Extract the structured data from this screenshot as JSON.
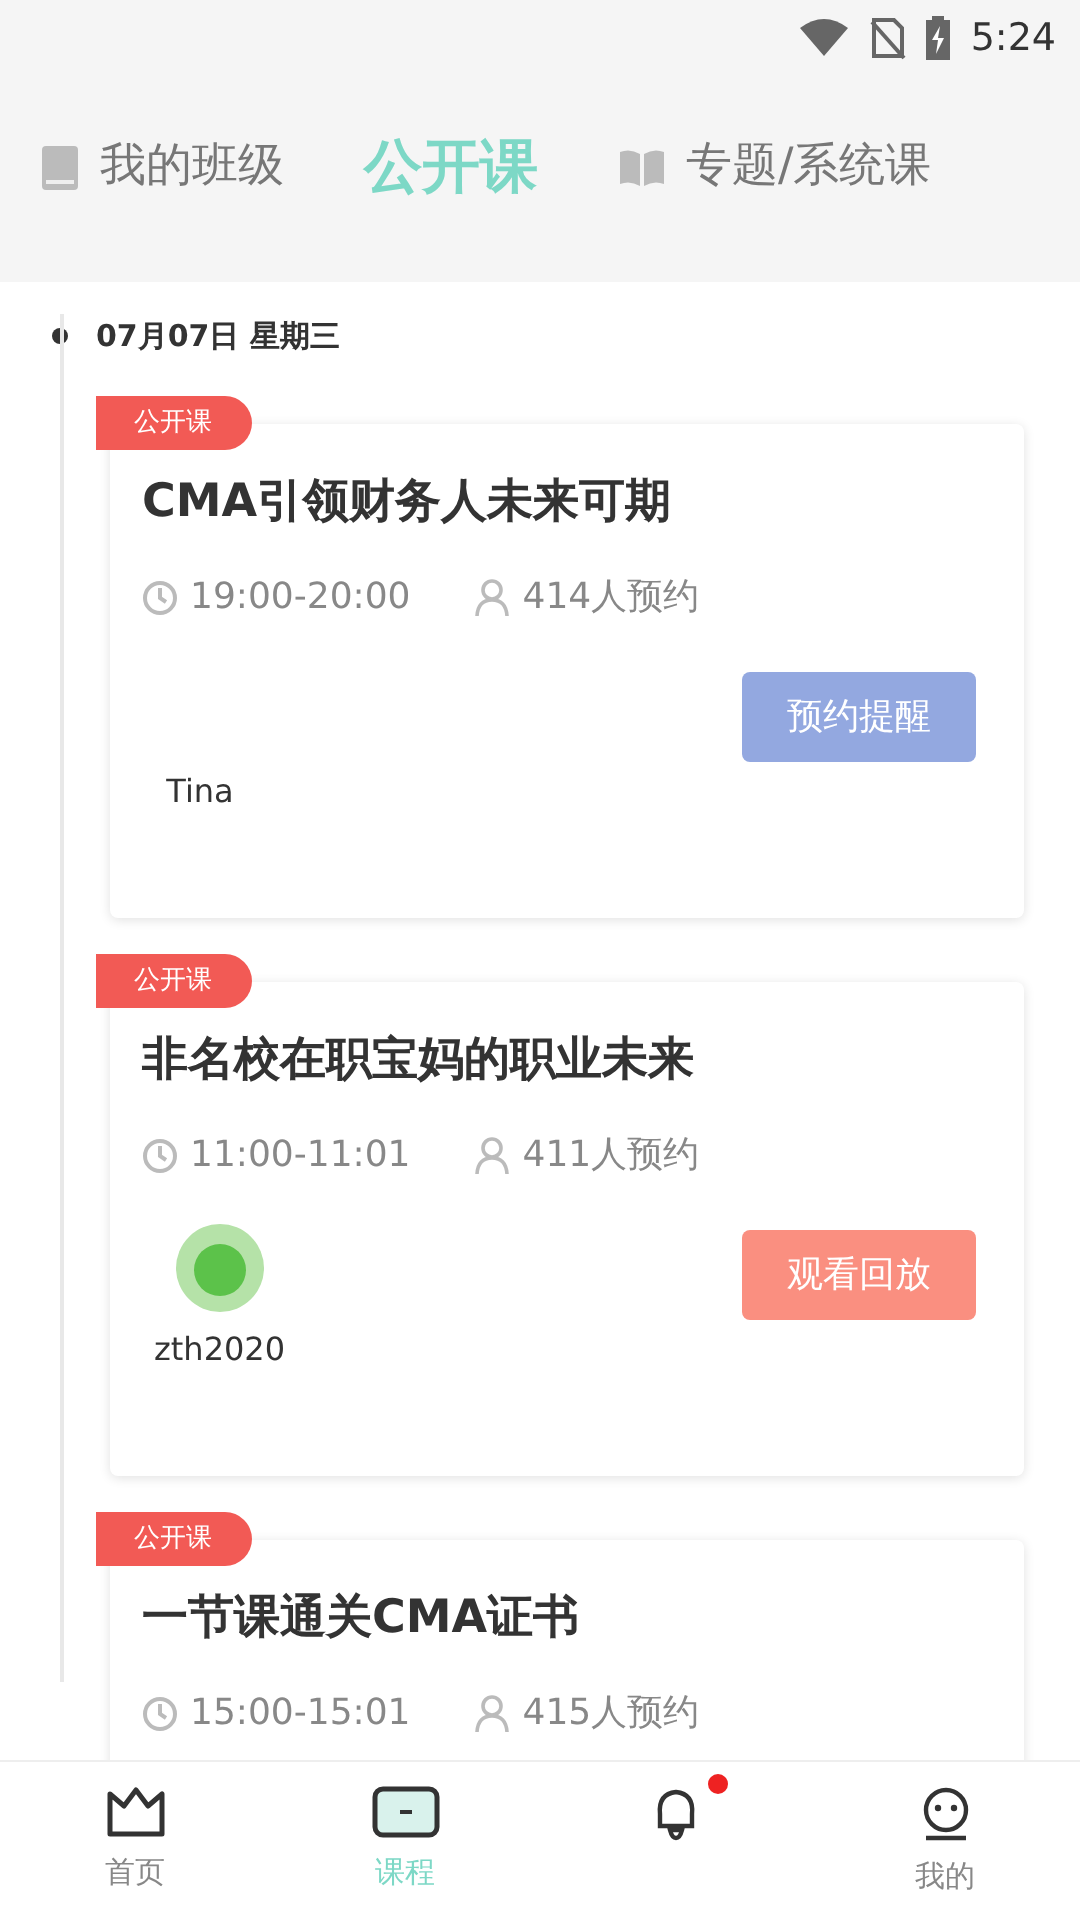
{
  "status_bar": {
    "time": "5:24"
  },
  "top_tabs": [
    {
      "label": "我的班级",
      "selected": false
    },
    {
      "label": "公开课",
      "selected": true
    },
    {
      "label": "专题/系统课",
      "selected": false
    }
  ],
  "date_header": "07月07日 星期三",
  "courses": [
    {
      "tag": "公开课",
      "title": "CMA引领财务人未来可期",
      "time": "19:00-20:00",
      "count": "414人预约",
      "button": {
        "kind": "remind",
        "label": "预约提醒"
      },
      "avatar": false,
      "teacher": "Tina"
    },
    {
      "tag": "公开课",
      "title": "非名校在职宝妈的职业未来",
      "time": "11:00-11:01",
      "count": "411人预约",
      "button": {
        "kind": "replay",
        "label": "观看回放"
      },
      "avatar": true,
      "teacher": "zth2020"
    },
    {
      "tag": "公开课",
      "title": "一节课通关CMA证书",
      "time": "15:00-15:01",
      "count": "415人预约"
    }
  ],
  "bottom_nav": [
    {
      "label": "首页",
      "selected": false
    },
    {
      "label": "课程",
      "selected": true
    },
    {
      "selected": false,
      "badge": true
    },
    {
      "label": "我的",
      "selected": false
    }
  ]
}
